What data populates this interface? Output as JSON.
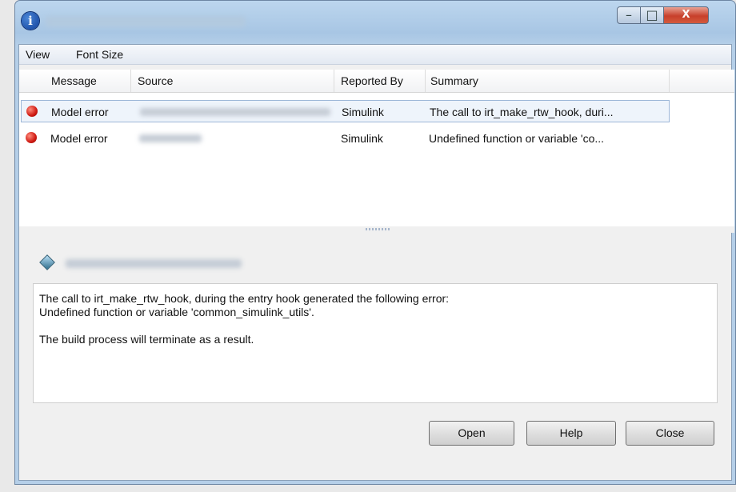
{
  "menu": [
    "View",
    "Font Size"
  ],
  "window_controls": {
    "minimize": "–",
    "maximize": "□",
    "close": "X"
  },
  "table": {
    "columns": [
      "Message",
      "Source",
      "Reported By",
      "Summary"
    ],
    "rows": [
      {
        "message": "Model error",
        "reported_by": "Simulink",
        "summary": "The call to irt_make_rtw_hook, duri...",
        "selected": true
      },
      {
        "message": "Model error",
        "reported_by": "Simulink",
        "summary": "Undefined function or variable 'co...",
        "selected": false
      }
    ]
  },
  "details": {
    "lines": [
      "The call to irt_make_rtw_hook, during the entry hook generated the following error:",
      "Undefined function or variable 'common_simulink_utils'.",
      "",
      "The build process will terminate as a result."
    ]
  },
  "buttons": {
    "open": "Open",
    "help": "Help",
    "close": "Close"
  },
  "icons": {
    "app": "info-icon",
    "error": "error-dot-icon",
    "detail": "model-block-icon"
  }
}
